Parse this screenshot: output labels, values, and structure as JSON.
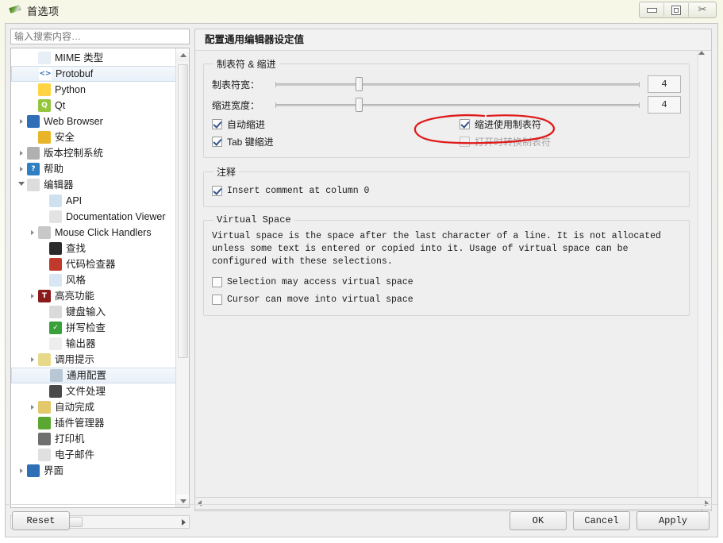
{
  "window": {
    "title": "首选项",
    "icon": "pen-icon",
    "controls": [
      {
        "name": "minimize-button",
        "glyph": "minimize"
      },
      {
        "name": "maximize-button",
        "glyph": "maximize"
      },
      {
        "name": "close-button",
        "glyph": "✂"
      }
    ]
  },
  "sidebar": {
    "search": {
      "value": "",
      "placeholder": "输入搜索内容…"
    },
    "items": [
      {
        "label": "MIME 类型",
        "indent": 1,
        "arrow": "none",
        "icon": "document-icon",
        "color": "#e8eef5",
        "glyph": "",
        "selected": false
      },
      {
        "label": "Protobuf",
        "indent": 1,
        "arrow": "none",
        "icon": "protobuf-icon",
        "color": "#ffffff",
        "glyph": "<>",
        "selected": true
      },
      {
        "label": "Python",
        "indent": 1,
        "arrow": "none",
        "icon": "python-icon",
        "color": "#ffd343",
        "glyph": "",
        "selected": false
      },
      {
        "label": "Qt",
        "indent": 1,
        "arrow": "none",
        "icon": "qt-icon",
        "color": "#94c63d",
        "glyph": "Q",
        "selected": false
      },
      {
        "label": "Web Browser",
        "indent": 0,
        "arrow": "collapsed",
        "icon": "web-browser-icon",
        "color": "#2f6fb5",
        "glyph": "",
        "selected": false
      },
      {
        "label": "安全",
        "indent": 1,
        "arrow": "none",
        "icon": "lock-icon",
        "color": "#e8b52a",
        "glyph": "",
        "selected": false
      },
      {
        "label": "版本控制系统",
        "indent": 0,
        "arrow": "collapsed",
        "icon": "database-icon",
        "color": "#b0b0b0",
        "glyph": "",
        "selected": false
      },
      {
        "label": "帮助",
        "indent": 0,
        "arrow": "collapsed",
        "icon": "help-icon",
        "color": "#2f7fc4",
        "glyph": "?",
        "selected": false
      },
      {
        "label": "编辑器",
        "indent": 0,
        "arrow": "expanded",
        "icon": "editor-icon",
        "color": "#dcdcdc",
        "glyph": "",
        "selected": false
      },
      {
        "label": "API",
        "indent": 2,
        "arrow": "none",
        "icon": "api-icon",
        "color": "#cfe0f0",
        "glyph": "",
        "selected": false
      },
      {
        "label": "Documentation Viewer",
        "indent": 2,
        "arrow": "none",
        "icon": "doc-viewer-icon",
        "color": "#e3e3e3",
        "glyph": "",
        "selected": false
      },
      {
        "label": "Mouse Click Handlers",
        "indent": 1,
        "arrow": "collapsed",
        "icon": "mouse-icon",
        "color": "#c8c8c8",
        "glyph": "",
        "selected": false
      },
      {
        "label": "查找",
        "indent": 2,
        "arrow": "none",
        "icon": "binoculars-icon",
        "color": "#2b2b2b",
        "glyph": "",
        "selected": false
      },
      {
        "label": "代码检查器",
        "indent": 2,
        "arrow": "none",
        "icon": "bug-icon",
        "color": "#c0392b",
        "glyph": "",
        "selected": false
      },
      {
        "label": "风格",
        "indent": 2,
        "arrow": "none",
        "icon": "style-icon",
        "color": "#d7e6f2",
        "glyph": "",
        "selected": false
      },
      {
        "label": "高亮功能",
        "indent": 1,
        "arrow": "collapsed",
        "icon": "highlight-icon",
        "color": "#8b1a1a",
        "glyph": "T",
        "selected": false
      },
      {
        "label": "键盘输入",
        "indent": 2,
        "arrow": "none",
        "icon": "keyboard-icon",
        "color": "#dadada",
        "glyph": "",
        "selected": false
      },
      {
        "label": "拼写检查",
        "indent": 2,
        "arrow": "none",
        "icon": "spellcheck-icon",
        "color": "#3aa13a",
        "glyph": "✓",
        "selected": false
      },
      {
        "label": "输出器",
        "indent": 2,
        "arrow": "none",
        "icon": "output-icon",
        "color": "#ededed",
        "glyph": "",
        "selected": false
      },
      {
        "label": "调用提示",
        "indent": 1,
        "arrow": "collapsed",
        "icon": "calltip-icon",
        "color": "#e8d98a",
        "glyph": "",
        "selected": false
      },
      {
        "label": "通用配置",
        "indent": 2,
        "arrow": "none",
        "icon": "wrench-icon",
        "color": "#b9c6d4",
        "glyph": "",
        "selected": true
      },
      {
        "label": "文件处理",
        "indent": 2,
        "arrow": "none",
        "icon": "save-disk-icon",
        "color": "#4a4a4a",
        "glyph": "",
        "selected": false
      },
      {
        "label": "自动完成",
        "indent": 1,
        "arrow": "collapsed",
        "icon": "autocomplete-icon",
        "color": "#e3c96b",
        "glyph": "",
        "selected": false
      },
      {
        "label": "插件管理器",
        "indent": 1,
        "arrow": "none",
        "icon": "plugin-icon",
        "color": "#5aa832",
        "glyph": "",
        "selected": false
      },
      {
        "label": "打印机",
        "indent": 1,
        "arrow": "none",
        "icon": "printer-icon",
        "color": "#6f6f6f",
        "glyph": "",
        "selected": false
      },
      {
        "label": "电子邮件",
        "indent": 1,
        "arrow": "none",
        "icon": "email-icon",
        "color": "#e0e0e0",
        "glyph": "",
        "selected": false
      },
      {
        "label": "界面",
        "indent": 0,
        "arrow": "collapsed",
        "icon": "desktop-icon",
        "color": "#2f6fb5",
        "glyph": "",
        "selected": false
      }
    ]
  },
  "panel": {
    "header": "配置通用编辑器设定值",
    "tabs_group": {
      "legend": "制表符 & 缩进",
      "tab_width": {
        "label": "制表符宽：",
        "value": "4",
        "slider_pct": 22
      },
      "indent_width": {
        "label": "缩进宽度：",
        "value": "4",
        "slider_pct": 22
      },
      "auto_indent": {
        "label": "自动缩进",
        "checked": true,
        "disabled": false
      },
      "tab_indents": {
        "label": "Tab 键缩进",
        "checked": true,
        "disabled": false
      },
      "indent_uses_tabs": {
        "label": "缩进使用制表符",
        "checked": true,
        "disabled": false
      },
      "convert_on_open": {
        "label": "打开时转换制表符",
        "checked": false,
        "disabled": true
      }
    },
    "comment_group": {
      "legend": "注释",
      "insert_comment": {
        "label": "Insert comment at column 0",
        "checked": true
      }
    },
    "virtual_space_group": {
      "legend": "Virtual Space",
      "description": "Virtual space is the space after the last character of a line. It is not allocated unless some text is entered or copied into it. Usage of virtual space can be configured with these selections.",
      "selection_access": {
        "label": "Selection may access virtual space",
        "checked": false
      },
      "cursor_move": {
        "label": "Cursor can move into virtual space",
        "checked": false
      }
    }
  },
  "annotation": {
    "color": "#e01b1b",
    "shape": "hand-drawn-ellipse",
    "targets": "indent-uses-tabs-checkbox"
  },
  "buttons": {
    "reset": "Reset",
    "ok": "OK",
    "cancel": "Cancel",
    "apply": "Apply"
  }
}
